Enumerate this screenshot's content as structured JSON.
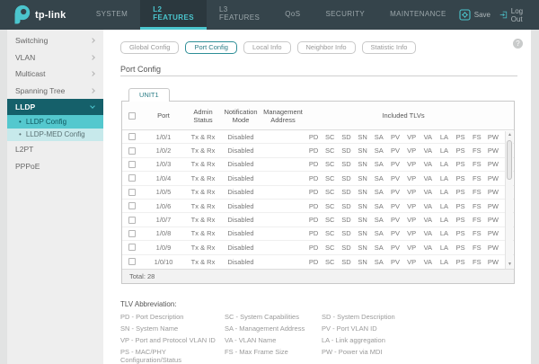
{
  "header": {
    "brand": "tp-link",
    "nav": [
      {
        "label": "SYSTEM",
        "active": false
      },
      {
        "label": "L2 FEATURES",
        "active": true
      },
      {
        "label": "L3 FEATURES",
        "active": false
      },
      {
        "label": "QoS",
        "active": false
      },
      {
        "label": "SECURITY",
        "active": false
      },
      {
        "label": "MAINTENANCE",
        "active": false
      }
    ],
    "save_label": "Save",
    "logout_label": "Log Out"
  },
  "sidebar": {
    "items": [
      {
        "label": "Switching",
        "chevron": "right"
      },
      {
        "label": "VLAN",
        "chevron": "right"
      },
      {
        "label": "Multicast",
        "chevron": "right"
      },
      {
        "label": "Spanning Tree",
        "chevron": "right"
      },
      {
        "label": "LLDP",
        "chevron": "down",
        "expanded": true
      },
      {
        "label": "LLDP Config",
        "sub": true,
        "active": true
      },
      {
        "label": "LLDP-MED Config",
        "sub": true,
        "active": false
      },
      {
        "label": "L2PT"
      },
      {
        "label": "PPPoE"
      }
    ]
  },
  "tabs": [
    {
      "label": "Global Config",
      "active": false
    },
    {
      "label": "Port Config",
      "active": true
    },
    {
      "label": "Local Info",
      "active": false
    },
    {
      "label": "Neighbor Info",
      "active": false
    },
    {
      "label": "Statistic Info",
      "active": false
    }
  ],
  "section_title": "Port Config",
  "help_label": "?",
  "unit_tab": "UNIT1",
  "table": {
    "headers": {
      "port": "Port",
      "admin": "Admin Status",
      "notification": "Notification Mode",
      "management": "Management Address",
      "tlvs": "Included TLVs"
    },
    "tlv_codes": [
      "PD",
      "SC",
      "SD",
      "SN",
      "SA",
      "PV",
      "VP",
      "VA",
      "LA",
      "PS",
      "FS",
      "PW"
    ],
    "rows": [
      {
        "port": "1/0/1",
        "admin_status": "Tx & Rx",
        "notification_mode": "Disabled",
        "management_address": ""
      },
      {
        "port": "1/0/2",
        "admin_status": "Tx & Rx",
        "notification_mode": "Disabled",
        "management_address": ""
      },
      {
        "port": "1/0/3",
        "admin_status": "Tx & Rx",
        "notification_mode": "Disabled",
        "management_address": ""
      },
      {
        "port": "1/0/4",
        "admin_status": "Tx & Rx",
        "notification_mode": "Disabled",
        "management_address": ""
      },
      {
        "port": "1/0/5",
        "admin_status": "Tx & Rx",
        "notification_mode": "Disabled",
        "management_address": ""
      },
      {
        "port": "1/0/6",
        "admin_status": "Tx & Rx",
        "notification_mode": "Disabled",
        "management_address": ""
      },
      {
        "port": "1/0/7",
        "admin_status": "Tx & Rx",
        "notification_mode": "Disabled",
        "management_address": ""
      },
      {
        "port": "1/0/8",
        "admin_status": "Tx & Rx",
        "notification_mode": "Disabled",
        "management_address": ""
      },
      {
        "port": "1/0/9",
        "admin_status": "Tx & Rx",
        "notification_mode": "Disabled",
        "management_address": ""
      },
      {
        "port": "1/0/10",
        "admin_status": "Tx & Rx",
        "notification_mode": "Disabled",
        "management_address": ""
      }
    ],
    "total": "Total: 28"
  },
  "abbr": {
    "title": "TLV Abbreviation:",
    "items": [
      "PD - Port Description",
      "SC - System Capabilities",
      "SD - System Description",
      "SN - System Name",
      "SA - Management Address",
      "PV - Port VLAN ID",
      "VP - Port and Protocol VLAN ID",
      "VA - VLAN Name",
      "LA - Link aggregation",
      "PS - MAC/PHY Configuration/Status",
      "FS - Max Frame Size",
      "PW - Power via MDI"
    ]
  },
  "colors": {
    "accent": "#4bc5cd",
    "header_bg": "#35444b",
    "sidebar_active_dark": "#15606a",
    "sidebar_sub_active": "#54c8ce",
    "sidebar_sub_light": "#c7e9eb"
  }
}
